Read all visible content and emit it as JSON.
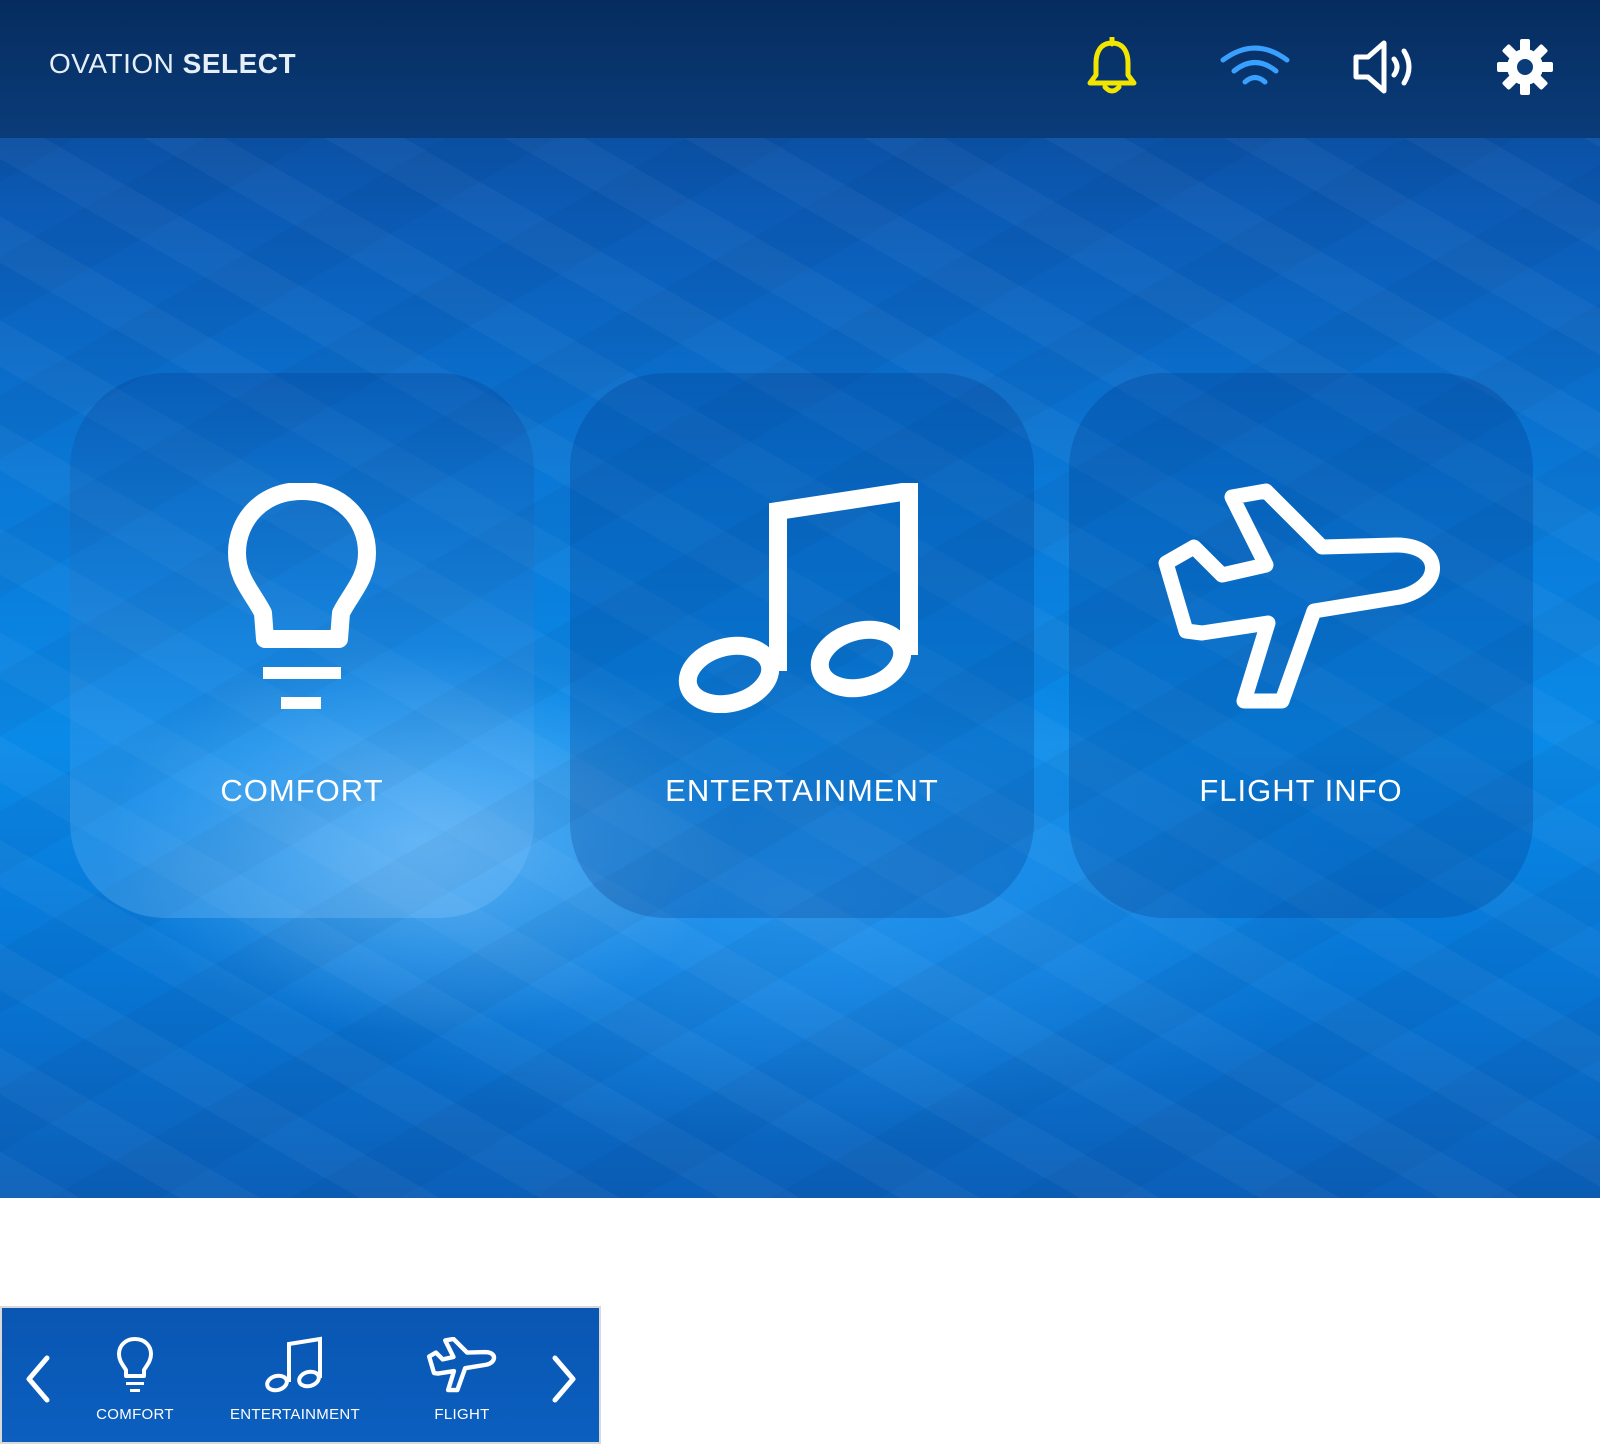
{
  "header": {
    "brand_light": "OVATION",
    "brand_bold": "SELECT",
    "icons": [
      "bell-icon",
      "wifi-icon",
      "volume-icon",
      "gear-icon"
    ]
  },
  "colors": {
    "bell": "#f2e600",
    "wifi": "#3aa0ff",
    "icon_white": "#ffffff"
  },
  "tiles": [
    {
      "label": "COMFORT",
      "icon": "lightbulb-icon"
    },
    {
      "label": "ENTERTAINMENT",
      "icon": "music-note-icon"
    },
    {
      "label": "FLIGHT INFO",
      "icon": "airplane-icon"
    }
  ],
  "minibar": {
    "items": [
      {
        "label": "COMFORT",
        "icon": "lightbulb-icon"
      },
      {
        "label": "ENTERTAINMENT",
        "icon": "music-note-icon"
      },
      {
        "label": "FLIGHT",
        "icon": "airplane-icon"
      }
    ]
  }
}
